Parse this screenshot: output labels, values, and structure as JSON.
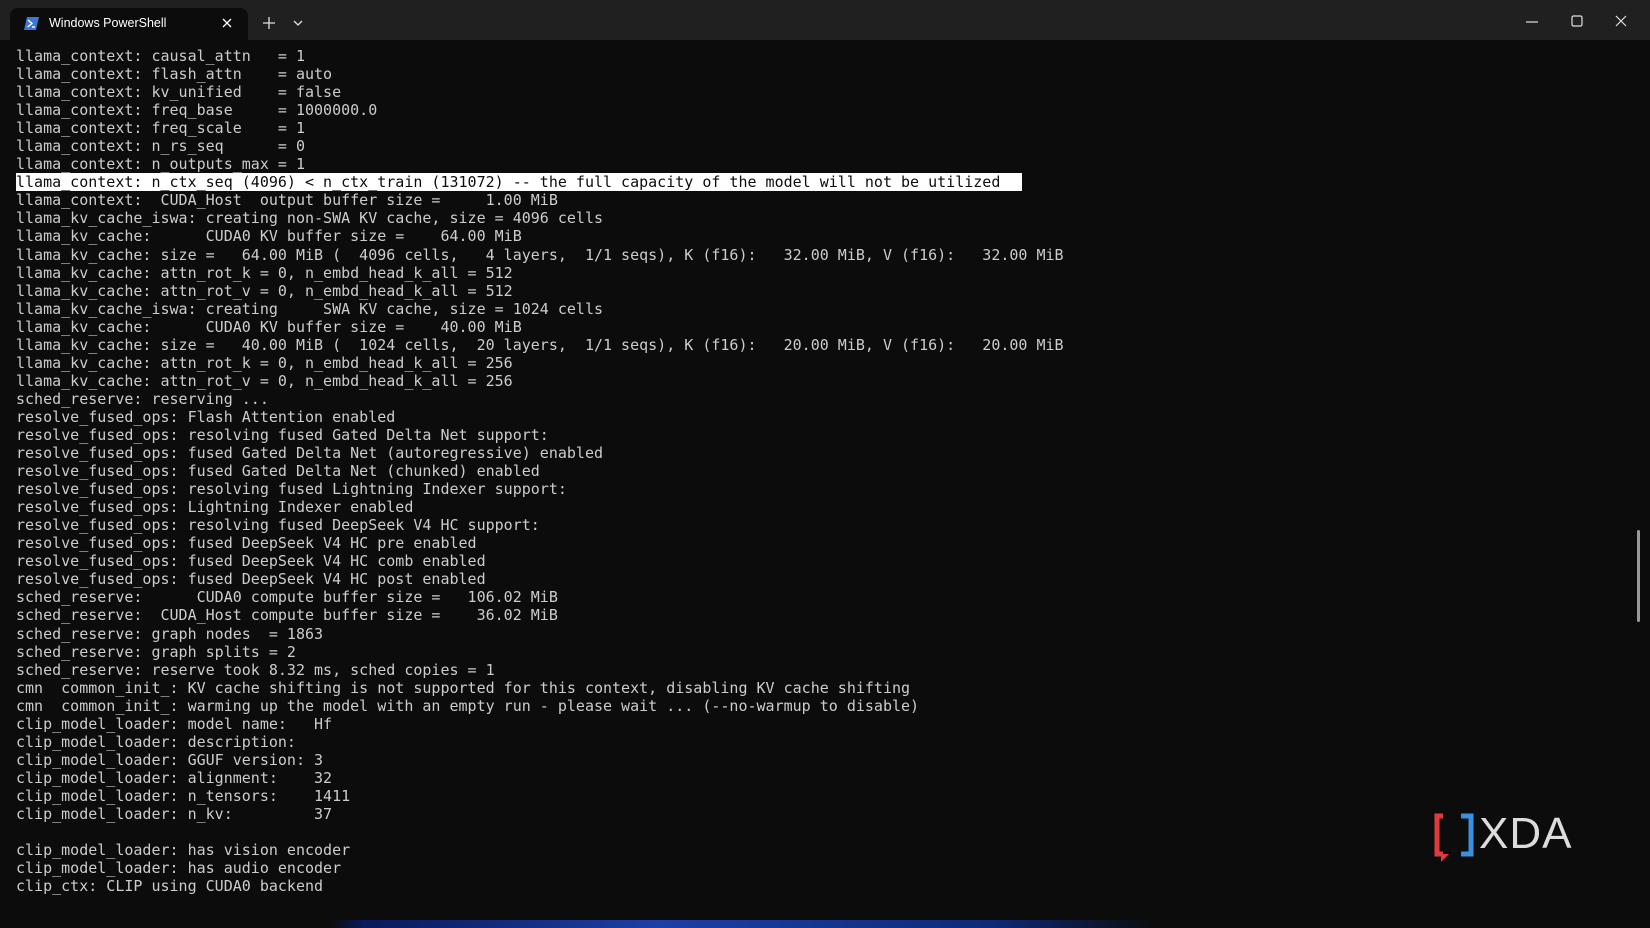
{
  "window": {
    "tab_title": "Windows PowerShell",
    "new_tab_icon": "plus-icon",
    "dropdown_icon": "chevron-down-icon",
    "minimize_icon": "minimize-icon",
    "maximize_icon": "maximize-icon",
    "close_icon": "close-icon"
  },
  "colors": {
    "background": "#0c0c0c",
    "titlebar": "#202020",
    "text": "#cccccc",
    "highlight_bg": "#ffffff"
  },
  "terminal": {
    "lines": [
      "llama_context: causal_attn   = 1",
      "llama_context: flash_attn    = auto",
      "llama_context: kv_unified    = false",
      "llama_context: freq_base     = 1000000.0",
      "llama_context: freq_scale    = 1",
      "llama_context: n_rs_seq      = 0",
      "llama_context: n_outputs_max = 1",
      "llama_context: n_ctx_seq (4096) < n_ctx_train (131072) -- the full capacity of the model will not be utilized",
      "llama_context:  CUDA_Host  output buffer size =     1.00 MiB",
      "llama_kv_cache_iswa: creating non-SWA KV cache, size = 4096 cells",
      "llama_kv_cache:      CUDA0 KV buffer size =    64.00 MiB",
      "llama_kv_cache: size =   64.00 MiB (  4096 cells,   4 layers,  1/1 seqs), K (f16):   32.00 MiB, V (f16):   32.00 MiB",
      "llama_kv_cache: attn_rot_k = 0, n_embd_head_k_all = 512",
      "llama_kv_cache: attn_rot_v = 0, n_embd_head_k_all = 512",
      "llama_kv_cache_iswa: creating     SWA KV cache, size = 1024 cells",
      "llama_kv_cache:      CUDA0 KV buffer size =    40.00 MiB",
      "llama_kv_cache: size =   40.00 MiB (  1024 cells,  20 layers,  1/1 seqs), K (f16):   20.00 MiB, V (f16):   20.00 MiB",
      "llama_kv_cache: attn_rot_k = 0, n_embd_head_k_all = 256",
      "llama_kv_cache: attn_rot_v = 0, n_embd_head_k_all = 256",
      "sched_reserve: reserving ...",
      "resolve_fused_ops: Flash Attention enabled",
      "resolve_fused_ops: resolving fused Gated Delta Net support:",
      "resolve_fused_ops: fused Gated Delta Net (autoregressive) enabled",
      "resolve_fused_ops: fused Gated Delta Net (chunked) enabled",
      "resolve_fused_ops: resolving fused Lightning Indexer support:",
      "resolve_fused_ops: Lightning Indexer enabled",
      "resolve_fused_ops: resolving fused DeepSeek V4 HC support:",
      "resolve_fused_ops: fused DeepSeek V4 HC pre enabled",
      "resolve_fused_ops: fused DeepSeek V4 HC comb enabled",
      "resolve_fused_ops: fused DeepSeek V4 HC post enabled",
      "sched_reserve:      CUDA0 compute buffer size =   106.02 MiB",
      "sched_reserve:  CUDA_Host compute buffer size =    36.02 MiB",
      "sched_reserve: graph nodes  = 1863",
      "sched_reserve: graph splits = 2",
      "sched_reserve: reserve took 8.32 ms, sched copies = 1",
      "cmn  common_init_: KV cache shifting is not supported for this context, disabling KV cache shifting",
      "cmn  common_init_: warming up the model with an empty run - please wait ... (--no-warmup to disable)",
      "clip_model_loader: model name:   Hf",
      "clip_model_loader: description:",
      "clip_model_loader: GGUF version: 3",
      "clip_model_loader: alignment:    32",
      "clip_model_loader: n_tensors:    1411",
      "clip_model_loader: n_kv:         37",
      "",
      "clip_model_loader: has vision encoder",
      "clip_model_loader: has audio encoder",
      "clip_ctx: CLIP using CUDA0 backend"
    ],
    "highlighted_line_index": 7
  },
  "watermark": {
    "text": "XDA"
  }
}
